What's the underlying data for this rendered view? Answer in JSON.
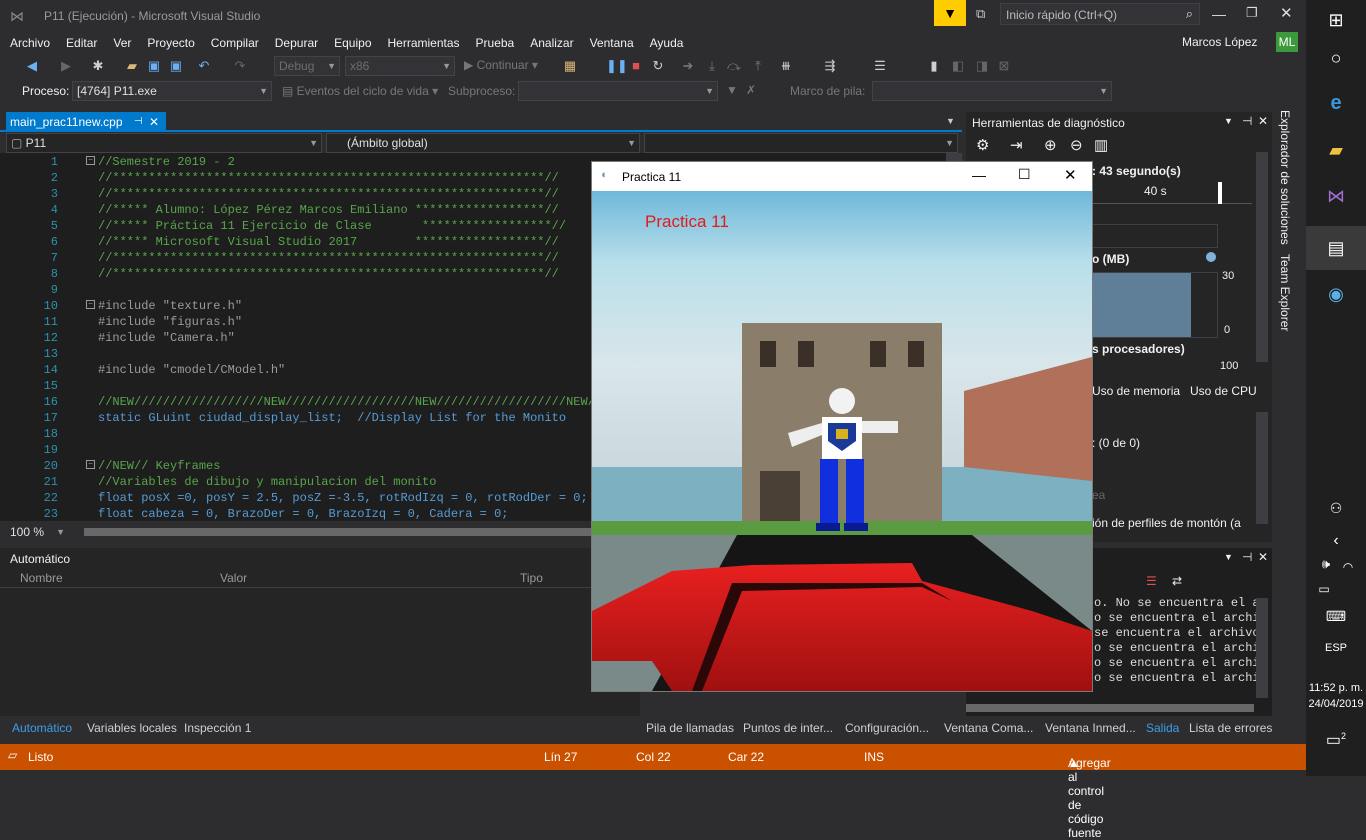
{
  "window": {
    "title": "P11 (Ejecución) - Microsoft Visual Studio",
    "quick_launch": "Inicio rápido (Ctrl+Q)",
    "user": "Marcos López",
    "user_initials": "ML"
  },
  "menu": [
    "Archivo",
    "Editar",
    "Ver",
    "Proyecto",
    "Compilar",
    "Depurar",
    "Equipo",
    "Herramientas",
    "Prueba",
    "Analizar",
    "Ventana",
    "Ayuda"
  ],
  "toolbar": {
    "config": "Debug",
    "platform": "x86",
    "continue": "Continuar"
  },
  "process": {
    "label": "Proceso:",
    "value": "[4764] P11.exe",
    "lifecycle": "Eventos del ciclo de vida",
    "thread_label": "Subproceso:",
    "stack_label": "Marco de pila:"
  },
  "editor": {
    "tab": "main_prac11new.cpp",
    "project": "P11",
    "scope": "(Ámbito global)",
    "zoom": "100 %",
    "lines": [
      {
        "n": "1",
        "t": "//Semestre 2019 - 2",
        "c": "c-com"
      },
      {
        "n": "2",
        "t": "//************************************************************//",
        "c": "c-com"
      },
      {
        "n": "3",
        "t": "//************************************************************//",
        "c": "c-com"
      },
      {
        "n": "4",
        "t": "//***** Alumno: López Pérez Marcos Emiliano ******************//",
        "c": "c-com"
      },
      {
        "n": "5",
        "t": "//***** Práctica 11 Ejercicio de Clase       ******************//",
        "c": "c-com"
      },
      {
        "n": "6",
        "t": "//***** Microsoft Visual Studio 2017        ******************//",
        "c": "c-com"
      },
      {
        "n": "7",
        "t": "//************************************************************//",
        "c": "c-com"
      },
      {
        "n": "8",
        "t": "//************************************************************//",
        "c": "c-com"
      },
      {
        "n": "9",
        "t": "",
        "c": "c-txt"
      },
      {
        "n": "10",
        "t": "#include \"texture.h\"",
        "c": "c-pp"
      },
      {
        "n": "11",
        "t": "#include \"figuras.h\"",
        "c": "c-pp"
      },
      {
        "n": "12",
        "t": "#include \"Camera.h\"",
        "c": "c-pp"
      },
      {
        "n": "13",
        "t": "",
        "c": "c-txt"
      },
      {
        "n": "14",
        "t": "#include \"cmodel/CModel.h\"",
        "c": "c-pp"
      },
      {
        "n": "15",
        "t": "",
        "c": "c-txt"
      },
      {
        "n": "16",
        "t": "//NEW//////////////////NEW//////////////////NEW//////////////////NEW////",
        "c": "c-com"
      },
      {
        "n": "17",
        "t": "static GLuint ciudad_display_list;  //Display List for the Monito",
        "c": "c-kw"
      },
      {
        "n": "18",
        "t": "",
        "c": "c-txt"
      },
      {
        "n": "19",
        "t": "",
        "c": "c-txt"
      },
      {
        "n": "20",
        "t": "//NEW// Keyframes",
        "c": "c-com"
      },
      {
        "n": "21",
        "t": "//Variables de dibujo y manipulacion del monito",
        "c": "c-com"
      },
      {
        "n": "22",
        "t": "float posX =0, posY = 2.5, posZ =-3.5, rotRodIzq = 0, rotRodDer = 0; //",
        "c": "c-kw"
      },
      {
        "n": "23",
        "t": "float cabeza = 0, BrazoDer = 0, BrazoIzq = 0, Cadera = 0;",
        "c": "c-kw"
      }
    ]
  },
  "auto": {
    "title": "Automático",
    "cols": [
      "Nombre",
      "Valor",
      "Tipo"
    ]
  },
  "diagnostics": {
    "title": "Herramientas de diagnóstico",
    "session": "43 segundo(s)",
    "tick": "40 s",
    "mem": "(MB)",
    "mem_max": "30",
    "mem_min": "0",
    "cpu": "s procesadores)",
    "cpu_max": "100",
    "tab_mem": "Uso de memoria",
    "tab_cpu": "Uso de CPU",
    "events": "(0 de 0)",
    "faded": "ea",
    "heap": "ión de perfiles de montón (a"
  },
  "output": {
    "lines": [
      "o. No se encuentra el a",
      "o se encuentra el archi",
      "se encuentra el archivo",
      "o se encuentra el archiv",
      "o se encuentra el archiv",
      "o se encuentra el archiv"
    ]
  },
  "sidestrip": [
    "Explorador de soluciones",
    "Team Explorer"
  ],
  "bottom_tabs": [
    "Automático",
    "Variables locales",
    "Inspección 1",
    "Pila de llamadas",
    "Puntos de inter...",
    "Configuración...",
    "Ventana Coma...",
    "Ventana Inmed...",
    "Salida",
    "Lista de errores"
  ],
  "status": {
    "ready": "Listo",
    "line": "Lín 27",
    "col": "Col 22",
    "car": "Car 22",
    "ins": "INS",
    "source": "Agregar al control de código fuente"
  },
  "app": {
    "title": "Practica 11",
    "label": "Practica 11"
  },
  "taskbar": {
    "lang": "ESP",
    "time": "11:52 p. m.",
    "date": "24/04/2019",
    "notif": "2"
  }
}
